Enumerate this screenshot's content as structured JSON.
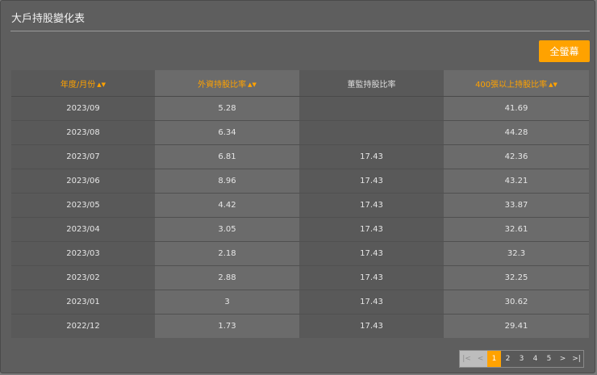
{
  "panel": {
    "title": "大戶持股變化表",
    "fullscreen_label": "全螢幕"
  },
  "table": {
    "columns": [
      {
        "label": "年度/月份",
        "sortable": true
      },
      {
        "label": "外資持股比率",
        "sortable": true
      },
      {
        "label": "董監持股比率",
        "sortable": false
      },
      {
        "label": "400張以上持股比率",
        "sortable": true
      }
    ],
    "rows": [
      [
        "2023/09",
        "5.28",
        "",
        "41.69"
      ],
      [
        "2023/08",
        "6.34",
        "",
        "44.28"
      ],
      [
        "2023/07",
        "6.81",
        "17.43",
        "42.36"
      ],
      [
        "2023/06",
        "8.96",
        "17.43",
        "43.21"
      ],
      [
        "2023/05",
        "4.42",
        "17.43",
        "33.87"
      ],
      [
        "2023/04",
        "3.05",
        "17.43",
        "32.61"
      ],
      [
        "2023/03",
        "2.18",
        "17.43",
        "32.3"
      ],
      [
        "2023/02",
        "2.88",
        "17.43",
        "32.25"
      ],
      [
        "2023/01",
        "3",
        "17.43",
        "30.62"
      ],
      [
        "2022/12",
        "1.73",
        "17.43",
        "29.41"
      ]
    ]
  },
  "pagination": {
    "first": "|<",
    "prev": "<",
    "pages": [
      "1",
      "2",
      "3",
      "4",
      "5"
    ],
    "active_page": "1",
    "next": ">",
    "last": ">|"
  },
  "colors": {
    "accent": "#ffa200",
    "panel_bg": "#5e5e5e"
  },
  "icons": {
    "sort": "sort-icon"
  }
}
